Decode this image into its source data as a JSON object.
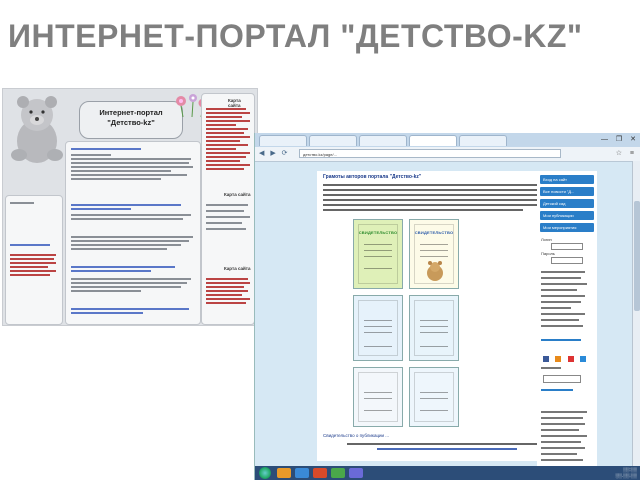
{
  "slide": {
    "title": "Интернет-портал \"Детство-kz\""
  },
  "left_screenshot": {
    "portal_title_line1": "Интернет-портал",
    "portal_title_line2": "\"Детство-kz\"",
    "sections": [
      "Карта сайта",
      "Карта сайта",
      "Карта сайта"
    ]
  },
  "right_screenshot": {
    "tabs": [
      "",
      "",
      "",
      "",
      ""
    ],
    "window_buttons": "— ❐ ✕",
    "url": "детство.kz/page/...",
    "page_heading": "Грамоты авторов портала \"Детство-kz\"",
    "certificates": [
      {
        "title": "СВИДЕТЕЛЬСТВО",
        "bg": "#dff0b8",
        "ink": "#2a8a2a"
      },
      {
        "title": "СВИДЕТЕЛЬСТВО",
        "bg": "#fdfbe8",
        "ink": "#2a5aa8"
      },
      {
        "title": "",
        "bg": "#e6f2fb",
        "ink": "#c22"
      },
      {
        "title": "",
        "bg": "#e8f4fb",
        "ink": "#2a8a2a"
      },
      {
        "title": "",
        "bg": "#f3f7fb",
        "ink": "#2a5aa8"
      },
      {
        "title": "",
        "bg": "#eef6fc",
        "ink": "#2a6ab8"
      }
    ],
    "footer_link": "Свидетельство о публикации ...",
    "sidebar_items": [
      "Вход на сайт",
      "Все новости \"Д...",
      "Детский сад",
      "Мои публикации",
      "Мои мероприятия"
    ],
    "sidebar_texts": [
      "Логин",
      "Пароль"
    ],
    "colors": {
      "sidebar_blue": "#2a7ec8",
      "taskbar": "#2c4d78",
      "page_bg": "#d6e8f4"
    }
  }
}
